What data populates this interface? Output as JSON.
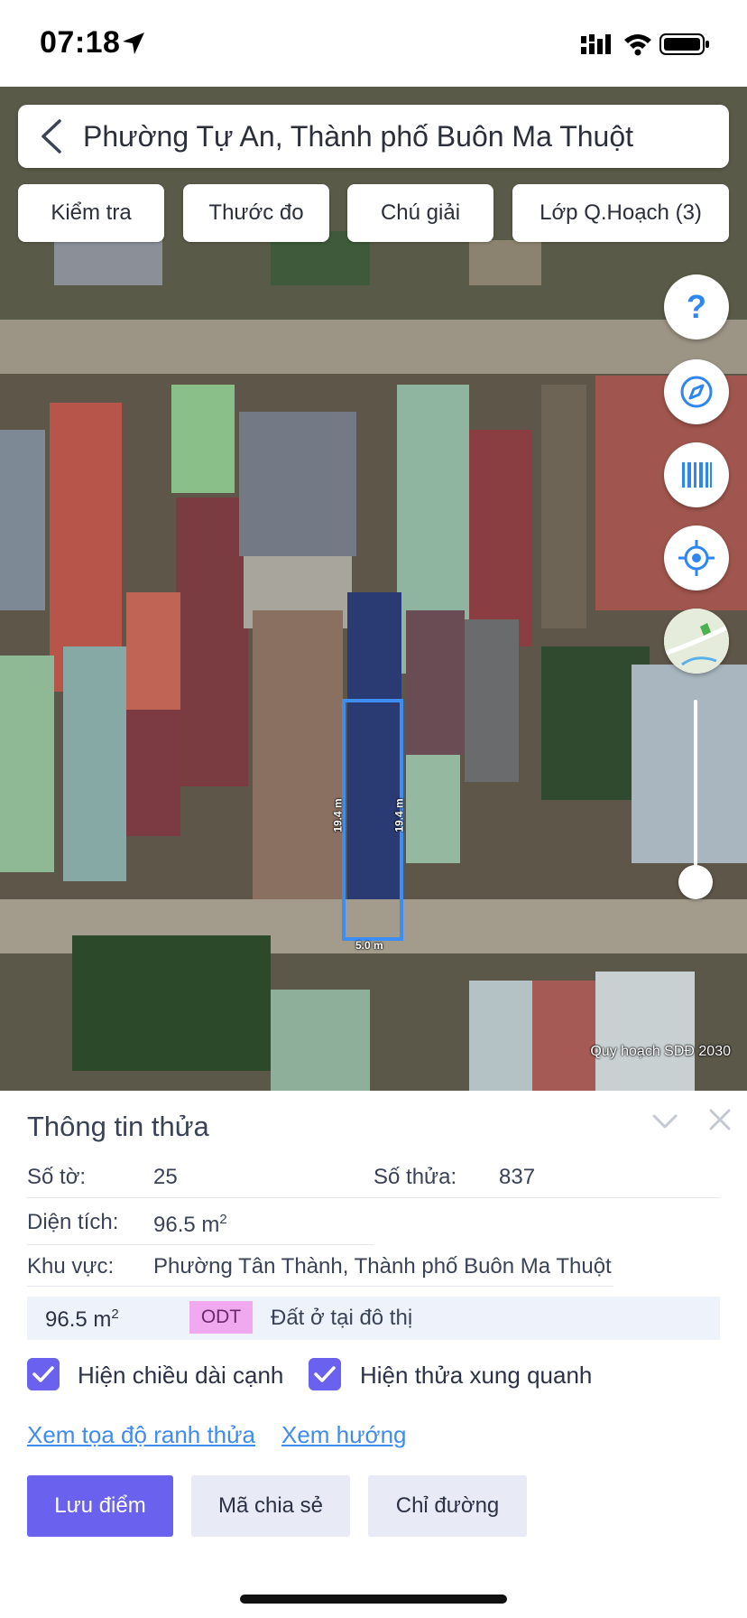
{
  "status_bar": {
    "time": "07:18"
  },
  "search": {
    "title": "Phường Tự An, Thành phố Buôn Ma Thuột"
  },
  "chips": [
    "Kiểm tra",
    "Thước đo",
    "Chú giải",
    "Lớp Q.Hoạch (3)"
  ],
  "map": {
    "fab_icons": [
      "help-icon",
      "compass-icon",
      "barcode-icon",
      "locate-icon",
      "map-layer-icon"
    ],
    "caption": "Quy hoạch SDĐ 2030",
    "parcel_dims": {
      "left": "19.4 m",
      "right": "19.4 m",
      "bottom": "5.0 m"
    }
  },
  "panel": {
    "title": "Thông tin thửa",
    "so_to_label": "Số tờ:",
    "so_to_value": "25",
    "so_thua_label": "Số thửa:",
    "so_thua_value": "837",
    "dien_tich_label": "Diện tích:",
    "dien_tich_value": "96.5 m",
    "khu_vuc_label": "Khu vực:",
    "khu_vuc_value": "Phường Tân Thành, Thành phố Buôn Ma Thuột",
    "land_use": {
      "area": "96.5 m",
      "code": "ODT",
      "desc": "Đất ở tại đô thị"
    },
    "checkbox_1": {
      "label": "Hiện chiều dài cạnh",
      "checked": true
    },
    "checkbox_2": {
      "label": "Hiện thửa xung quanh",
      "checked": true
    },
    "link_1": "Xem tọa độ ranh thửa",
    "link_2": "Xem hướng",
    "buttons": {
      "save": "Lưu điểm",
      "share": "Mã chia sẻ",
      "directions": "Chỉ đường"
    }
  },
  "colors": {
    "accent": "#6a62ee",
    "link": "#3f8cf0",
    "parcel": "#3d8ef2",
    "odt_badge": "#f0a8ee"
  }
}
